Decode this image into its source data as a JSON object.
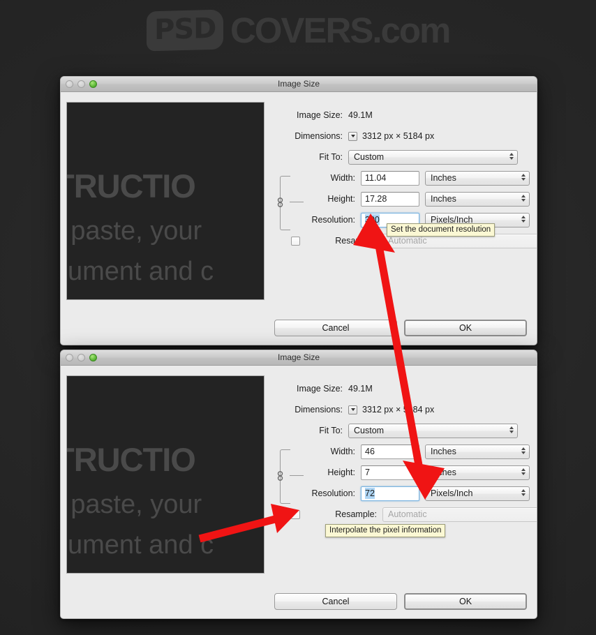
{
  "watermark": {
    "badge": "PSD",
    "text": "COVERS.com"
  },
  "colors": {
    "background": "#262626",
    "dialog_face": "#ebebeb",
    "arrow_red": "#f01414",
    "selection_blue": "#aed5f4",
    "tooltip_yellow": "#fbf8d4",
    "preview_bg": "#232323",
    "preview_text": "#4a4a4a"
  },
  "preview": {
    "line1": "TRUCTIO",
    "line2": "r paste, your",
    "line3": "cument and c"
  },
  "dialog1": {
    "title": "Image Size",
    "traffic_lights": [
      "close-disabled",
      "minimize-disabled",
      "zoom-green"
    ],
    "gear_icon": "gear-icon",
    "image_size_label": "Image Size:",
    "image_size_value": "49.1M",
    "dimensions_label": "Dimensions:",
    "dimensions_value": "3312 px  ×  5184 px",
    "fit_to_label": "Fit To:",
    "fit_to_value": "Custom",
    "width_label": "Width:",
    "width_value": "11.04",
    "width_unit": "Inches",
    "height_label": "Height:",
    "height_value": "17.28",
    "height_unit": "Inches",
    "resolution_label": "Resolution:",
    "resolution_value": "300",
    "resolution_unit": "Pixels/Inch",
    "resample_label": "Resample:",
    "resample_value": "Automatic",
    "resample_checked": false,
    "cancel_label": "Cancel",
    "ok_label": "OK",
    "tooltip": "Set the document resolution"
  },
  "dialog2": {
    "title": "Image Size",
    "traffic_lights": [
      "close-disabled",
      "minimize-disabled",
      "zoom-green"
    ],
    "gear_icon": "gear-icon",
    "image_size_label": "Image Size:",
    "image_size_value": "49.1M",
    "dimensions_label": "Dimensions:",
    "dimensions_value": "3312 px  ×  5184 px",
    "fit_to_label": "Fit To:",
    "fit_to_value": "Custom",
    "width_label": "Width:",
    "width_value": "46",
    "width_unit": "Inches",
    "height_label": "Height:",
    "height_value": "7",
    "height_unit": "Inches",
    "resolution_label": "Resolution:",
    "resolution_value": "72",
    "resolution_unit": "Pixels/Inch",
    "resample_label": "Resample:",
    "resample_value": "Automatic",
    "resample_checked": false,
    "cancel_label": "Cancel",
    "ok_label": "OK",
    "tooltip": "Interpolate the pixel information"
  },
  "annotations": {
    "arrow_double": "double-headed-arrow-from-resolution-300-to-resolution-72",
    "arrow_resample": "arrow-pointing-to-resample-checkbox"
  }
}
